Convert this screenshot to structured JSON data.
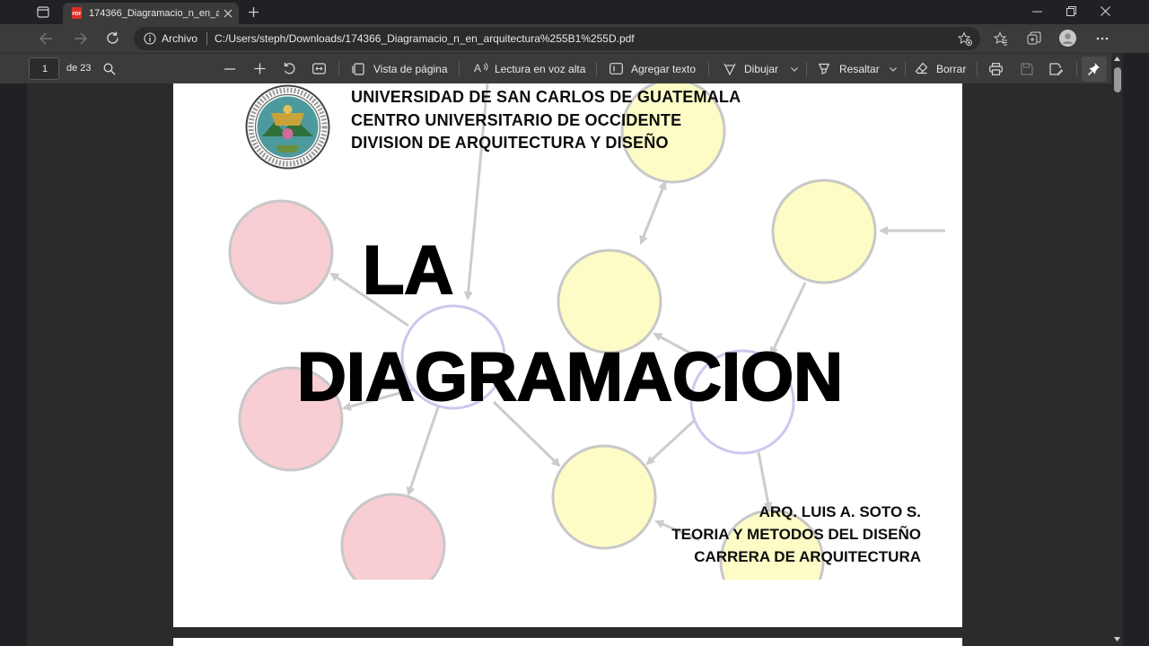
{
  "browser": {
    "tab_title": "174366_Diagramacio_n_en_arqui",
    "address_label": "Archivo",
    "url": "C:/Users/steph/Downloads/174366_Diagramacio_n_en_arquitectura%255B1%255D.pdf"
  },
  "pdf_toolbar": {
    "page_number": "1",
    "page_total": "de 23",
    "page_view": "Vista de página",
    "read_aloud": "Lectura en voz alta",
    "add_text": "Agregar texto",
    "draw": "Dibujar",
    "highlight": "Resaltar",
    "erase": "Borrar"
  },
  "document": {
    "header": [
      "UNIVERSIDAD DE SAN CARLOS DE GUATEMALA",
      "CENTRO UNIVERSITARIO DE OCCIDENTE",
      "DIVISION DE ARQUITECTURA Y DISEÑO"
    ],
    "title_line1": "LA",
    "title_line2": "DIAGRAMACION",
    "footer": [
      "ARQ. LUIS A. SOTO S.",
      "TEORIA Y METODOS DEL DISEÑO",
      "CARRERA DE ARQUITECTURA"
    ]
  },
  "colors": {
    "node_red": "#f8cdd3",
    "node_yellow": "#fdfcc6",
    "node_blue_stroke": "#c9c9ee",
    "arrow_gray": "#cccccc"
  }
}
